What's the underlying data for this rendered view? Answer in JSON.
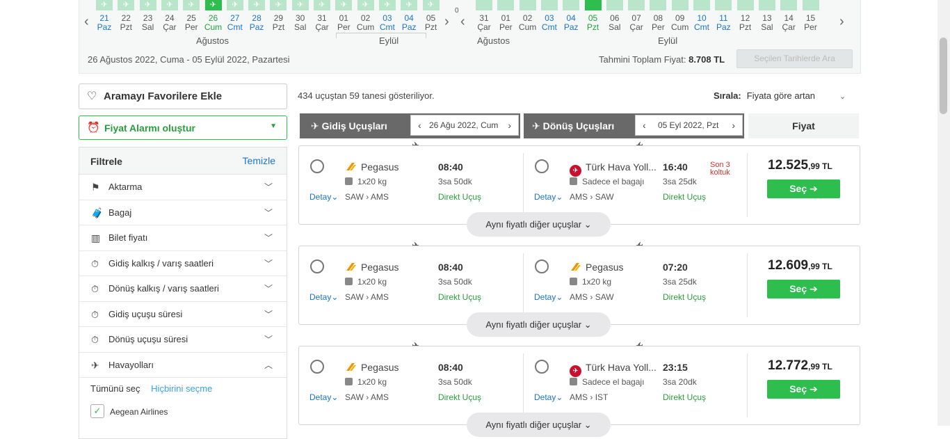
{
  "calendar": {
    "outbound": {
      "days": [
        {
          "num": "21",
          "dow": "Paz",
          "color": "blue"
        },
        {
          "num": "22",
          "dow": "Pzt",
          "color": "normal"
        },
        {
          "num": "23",
          "dow": "Sal",
          "color": "normal"
        },
        {
          "num": "24",
          "dow": "Çar",
          "color": "normal"
        },
        {
          "num": "25",
          "dow": "Per",
          "color": "normal"
        },
        {
          "num": "26",
          "dow": "Cum",
          "color": "green"
        },
        {
          "num": "27",
          "dow": "Cmt",
          "color": "blue"
        },
        {
          "num": "28",
          "dow": "Paz",
          "color": "blue"
        },
        {
          "num": "29",
          "dow": "Pzt",
          "color": "normal"
        },
        {
          "num": "30",
          "dow": "Sal",
          "color": "normal"
        },
        {
          "num": "31",
          "dow": "Çar",
          "color": "normal"
        },
        {
          "num": "01",
          "dow": "Per",
          "color": "normal"
        },
        {
          "num": "02",
          "dow": "Cum",
          "color": "normal"
        },
        {
          "num": "03",
          "dow": "Cmt",
          "color": "blue"
        },
        {
          "num": "04",
          "dow": "Paz",
          "color": "blue"
        },
        {
          "num": "05",
          "dow": "Pzt",
          "color": "normal"
        }
      ],
      "month1": "Ağustos",
      "month2": "Eylül"
    },
    "inbound": {
      "days": [
        {
          "num": "31",
          "dow": "Çar",
          "color": "normal"
        },
        {
          "num": "01",
          "dow": "Per",
          "color": "normal"
        },
        {
          "num": "02",
          "dow": "Cum",
          "color": "normal"
        },
        {
          "num": "03",
          "dow": "Cmt",
          "color": "blue"
        },
        {
          "num": "04",
          "dow": "Paz",
          "color": "blue"
        },
        {
          "num": "05",
          "dow": "Pzt",
          "color": "green"
        },
        {
          "num": "06",
          "dow": "Sal",
          "color": "normal"
        },
        {
          "num": "07",
          "dow": "Çar",
          "color": "normal"
        },
        {
          "num": "08",
          "dow": "Per",
          "color": "normal"
        },
        {
          "num": "09",
          "dow": "Cum",
          "color": "normal"
        },
        {
          "num": "10",
          "dow": "Cmt",
          "color": "blue"
        },
        {
          "num": "11",
          "dow": "Paz",
          "color": "blue"
        },
        {
          "num": "12",
          "dow": "Pzt",
          "color": "normal"
        },
        {
          "num": "13",
          "dow": "Sal",
          "color": "normal"
        },
        {
          "num": "14",
          "dow": "Çar",
          "color": "normal"
        },
        {
          "num": "15",
          "dow": "Per",
          "color": "normal"
        }
      ],
      "month1": "Ağustos",
      "month2": "Eylül"
    },
    "zero_label": "0",
    "date_range": "26 Ağustos 2022, Cuma -  05 Eylül 2022, Pazartesi",
    "total_label": "Tahmini Toplam Fiyat: ",
    "total_value": "8.708 TL",
    "search_button": "Seçilen Tarihlerde Ara"
  },
  "sidebar": {
    "favorite_label": "Aramayı Favorilere Ekle",
    "alarm_label": "Fiyat Alarmı oluştur",
    "filter_title": "Filtrele",
    "clear_label": "Temizle",
    "filters": [
      {
        "label": "Aktarma",
        "icon": "flag-icon"
      },
      {
        "label": "Bagaj",
        "icon": "luggage-icon"
      },
      {
        "label": "Bilet fiyatı",
        "icon": "chart-icon"
      },
      {
        "label": "Gidiş kalkış / varış saatleri",
        "icon": "stopwatch-icon"
      },
      {
        "label": "Dönüş kalkış / varış saatleri",
        "icon": "stopwatch-icon"
      },
      {
        "label": "Gidiş uçuşu süresi",
        "icon": "stopwatch-icon"
      },
      {
        "label": "Dönüş uçuşu süresi",
        "icon": "stopwatch-icon"
      },
      {
        "label": "Havayolları",
        "icon": "plane-icon"
      }
    ],
    "select_all": "Tümünü seç",
    "select_none": "Hiçbirini seçme",
    "airline_option": "Aegean Airlines"
  },
  "results": {
    "count_text": "434 uçuştan 59 tanesi gösteriliyor.",
    "sort_label": "Sırala:",
    "sort_value": "Fiyata göre artan",
    "outbound_title": "Gidiş Uçuşları",
    "outbound_date": "26 Ağu 2022, Cum",
    "return_title": "Dönüş Uçuşları",
    "return_date": "05 Eyl 2022, Pzt",
    "price_title": "Fiyat",
    "detail_label": "Detay",
    "direct_label": "Direkt Uçuş",
    "select_label": "Seç",
    "same_price_label": "Aynı fiyatlı diğer uçuşlar",
    "cards": [
      {
        "out": {
          "airline": "Pegasus",
          "logo": "pegasus",
          "bag": "1x20 kg",
          "time": "08:40",
          "duration": "3sa 50dk",
          "from": "SAW",
          "to": "AMS"
        },
        "ret": {
          "airline": "Türk Hava Yoll...",
          "logo": "thy",
          "bag": "Sadece el bagajı",
          "time": "16:40",
          "duration": "3sa 25dk",
          "from": "AMS",
          "to": "SAW",
          "seats": "Son 3\nkoltuk"
        },
        "price_main": "12.525",
        "price_cents": ",99",
        "currency": " TL"
      },
      {
        "out": {
          "airline": "Pegasus",
          "logo": "pegasus",
          "bag": "1x20 kg",
          "time": "08:40",
          "duration": "3sa 50dk",
          "from": "SAW",
          "to": "AMS"
        },
        "ret": {
          "airline": "Pegasus",
          "logo": "pegasus",
          "bag": "1x20 kg",
          "time": "07:20",
          "duration": "3sa 25dk",
          "from": "AMS",
          "to": "SAW",
          "seats": ""
        },
        "price_main": "12.609",
        "price_cents": ",99",
        "currency": " TL"
      },
      {
        "out": {
          "airline": "Pegasus",
          "logo": "pegasus",
          "bag": "1x20 kg",
          "time": "08:40",
          "duration": "3sa 50dk",
          "from": "SAW",
          "to": "AMS"
        },
        "ret": {
          "airline": "Türk Hava Yoll...",
          "logo": "thy",
          "bag": "Sadece el bagajı",
          "time": "23:15",
          "duration": "3sa 20dk",
          "from": "AMS",
          "to": "IST",
          "seats": ""
        },
        "price_main": "12.772",
        "price_cents": ",99",
        "currency": " TL"
      }
    ]
  }
}
